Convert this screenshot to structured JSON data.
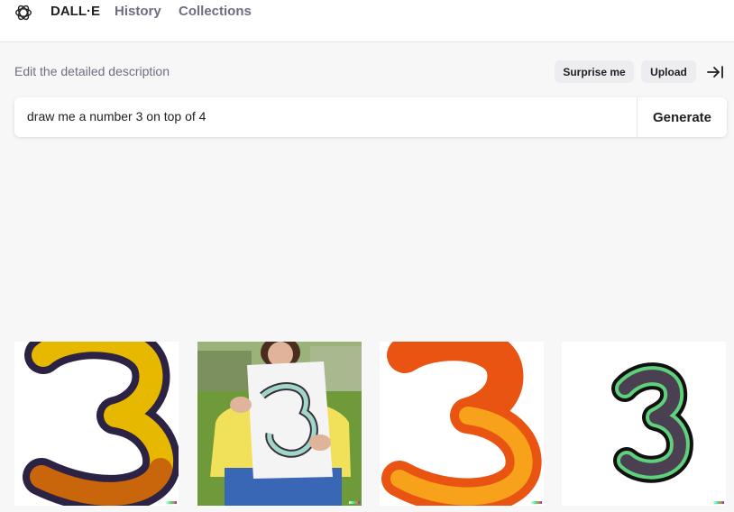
{
  "header": {
    "brand": "DALL·E",
    "nav": {
      "history": "History",
      "collections": "Collections"
    }
  },
  "editor": {
    "hint": "Edit the detailed description",
    "surprise_label": "Surprise me",
    "upload_label": "Upload",
    "prompt_value": "draw me a number 3 on top of 4",
    "generate_label": "Generate"
  },
  "icons": {
    "logo": "openai-logo-icon",
    "collapse": "collapse-sidebar-icon"
  },
  "results": [
    {
      "subject": "number-3-yellow-brown-outlined"
    },
    {
      "subject": "girl-holding-paper-with-3"
    },
    {
      "subject": "number-3-orange"
    },
    {
      "subject": "number-3-dark-green-outlined"
    }
  ],
  "colors": {
    "background": "#f7f7f8",
    "text": "#202123",
    "muted": "#6e6e80",
    "pill": "#ececf1"
  }
}
